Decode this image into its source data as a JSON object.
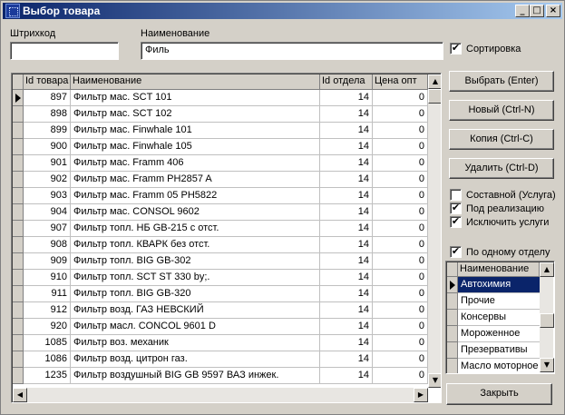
{
  "window": {
    "title": "Выбор товара",
    "minimize": "_",
    "maximize": "□",
    "close": "×"
  },
  "search": {
    "barcode_label": "Штрихкод",
    "barcode_value": "",
    "name_label": "Наименование",
    "name_value": "Филь",
    "sort_label": "Сортировка",
    "sort_checked": true
  },
  "grid": {
    "columns": [
      "Id товара",
      "Наименование",
      "Id отдела",
      "Цена опт"
    ],
    "rows": [
      {
        "id": "897",
        "name": "Фильтр мас. SCT 101",
        "dept": "14",
        "price": "0",
        "current": true
      },
      {
        "id": "898",
        "name": "Фильтр мас. SCT 102",
        "dept": "14",
        "price": "0"
      },
      {
        "id": "899",
        "name": "Фильтр мас. Finwhale 101",
        "dept": "14",
        "price": "0"
      },
      {
        "id": "900",
        "name": "Фильтр мас. Finwhale 105",
        "dept": "14",
        "price": "0"
      },
      {
        "id": "901",
        "name": "Фильтр мас. Framm 406",
        "dept": "14",
        "price": "0"
      },
      {
        "id": "902",
        "name": "Фильтр мас. Framm PH2857 A",
        "dept": "14",
        "price": "0"
      },
      {
        "id": "903",
        "name": "Фильтр мас. Framm 05 PH5822",
        "dept": "14",
        "price": "0"
      },
      {
        "id": "904",
        "name": "Фильтр мас. CONSOL 9602",
        "dept": "14",
        "price": "0"
      },
      {
        "id": "907",
        "name": "Фильтр топл. НБ GB-215 с отст.",
        "dept": "14",
        "price": "0"
      },
      {
        "id": "908",
        "name": "Фильтр топл. КВАРК без отст.",
        "dept": "14",
        "price": "0"
      },
      {
        "id": "909",
        "name": "Фильтр топл. BIG GB-302",
        "dept": "14",
        "price": "0"
      },
      {
        "id": "910",
        "name": "Фильтр топл. SCT ST 330 by;.",
        "dept": "14",
        "price": "0"
      },
      {
        "id": "911",
        "name": "Фильтр топл. BIG GB-320",
        "dept": "14",
        "price": "0"
      },
      {
        "id": "912",
        "name": "Фильтр возд. ГАЗ НЕВСКИЙ",
        "dept": "14",
        "price": "0"
      },
      {
        "id": "920",
        "name": "Фильтр масл. CONCOL 9601 D",
        "dept": "14",
        "price": "0"
      },
      {
        "id": "1085",
        "name": "Фильтр воз. механик",
        "dept": "14",
        "price": "0"
      },
      {
        "id": "1086",
        "name": "Фильтр возд. цитрон газ.",
        "dept": "14",
        "price": "0"
      },
      {
        "id": "1235",
        "name": "Фильтр воздушный BIG GB 9597 ВАЗ инжек.",
        "dept": "14",
        "price": "0"
      }
    ]
  },
  "buttons": {
    "select": "Выбрать (Enter)",
    "new": "Новый (Ctrl-N)",
    "copy": "Копия (Ctrl-C)",
    "delete": "Удалить (Ctrl-D)",
    "close": "Закрыть"
  },
  "options": {
    "composite": {
      "label": "Составной (Услуга)",
      "checked": false
    },
    "consignment": {
      "label": "Под реализацию",
      "checked": true
    },
    "exclude_services": {
      "label": "Исключить услуги",
      "checked": true
    },
    "by_department": {
      "label": "По одному отделу",
      "checked": true
    }
  },
  "departments": {
    "header": "Наименование",
    "items": [
      "Автохимия",
      "Прочие",
      "Консервы",
      "Мороженное",
      "Презервативы",
      "Масло моторное"
    ],
    "selected_index": 0
  },
  "icons": {
    "check": "✔",
    "up": "▲",
    "down": "▼",
    "left": "◀",
    "right": "▶"
  },
  "colors": {
    "title_start": "#0a246a",
    "title_end": "#a6caf0",
    "selection": "#0a246a",
    "face": "#d4d0c8"
  }
}
